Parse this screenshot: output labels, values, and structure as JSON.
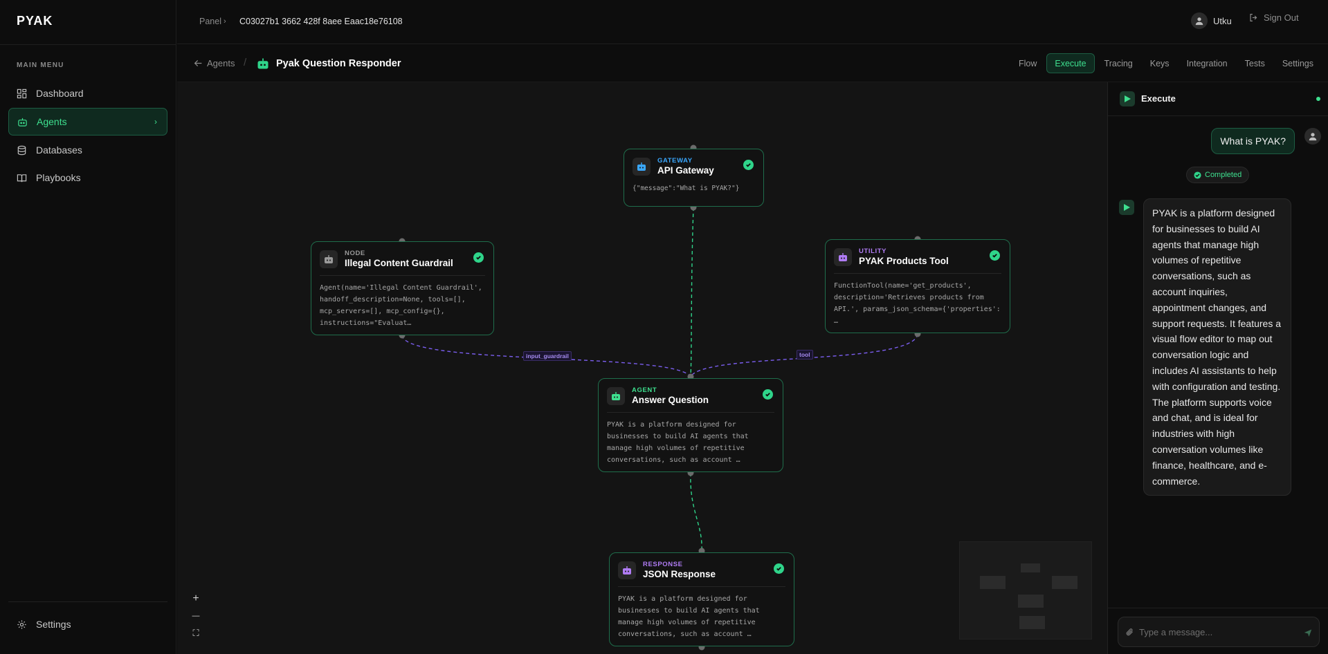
{
  "sidebar": {
    "logo": "PYAK",
    "menu_title": "MAIN MENU",
    "items": [
      {
        "label": "Dashboard"
      },
      {
        "label": "Agents"
      },
      {
        "label": "Databases"
      },
      {
        "label": "Playbooks"
      }
    ],
    "settings_label": "Settings"
  },
  "topbar": {
    "breadcrumb_root": "Panel",
    "breadcrumb_id": "C03027b1 3662 428f 8aee Eaac18e76108",
    "user_name": "Utku",
    "sign_out": "Sign Out"
  },
  "subbar": {
    "back_label": "Agents",
    "agent_name": "Pyak Question Responder",
    "tabs": [
      {
        "label": "Flow"
      },
      {
        "label": "Execute"
      },
      {
        "label": "Tracing"
      },
      {
        "label": "Keys"
      },
      {
        "label": "Integration"
      },
      {
        "label": "Tests"
      },
      {
        "label": "Settings"
      }
    ],
    "active_tab": "Execute"
  },
  "flow": {
    "nodes": {
      "gateway": {
        "type": "GATEWAY",
        "name": "API Gateway",
        "body": "{\"message\":\"What is PYAK?\"}",
        "color": "#3aa8ff"
      },
      "guardrail": {
        "type": "NODE",
        "name": "Illegal Content Guardrail",
        "body": "Agent(name='Illegal Content Guardrail', handoff_description=None, tools=[], mcp_servers=[], mcp_config={}, instructions=\"Evaluat…",
        "color": "#9a9a9a"
      },
      "tool": {
        "type": "UTILITY",
        "name": "PYAK Products Tool",
        "body": "FunctionTool(name='get_products', description='Retrieves products from API.', params_json_schema={'properties': …",
        "color": "#b07cf5"
      },
      "agent": {
        "type": "AGENT",
        "name": "Answer Question",
        "body": "PYAK is a platform designed for businesses to build AI agents that manage high volumes of repetitive conversations, such as account …",
        "color": "#3ee08f"
      },
      "response": {
        "type": "RESPONSE",
        "name": "JSON Response",
        "body": "PYAK is a platform designed for businesses to build AI agents that manage high volumes of repetitive conversations, such as account …",
        "color": "#b07cf5"
      }
    },
    "edge_labels": {
      "guardrail": "input_guardrail",
      "tool": "tool"
    },
    "zoom_in": "+",
    "zoom_out": "—",
    "fit": "⛶"
  },
  "execute": {
    "title": "Execute",
    "user_message": "What is PYAK?",
    "status": "Completed",
    "bot_message": "PYAK is a platform designed for businesses to build AI agents that manage high volumes of repetitive conversations, such as account inquiries, appointment changes, and support requests. It features a visual flow editor to map out conversation logic and includes AI assistants to help with configuration and testing. The platform supports voice and chat, and is ideal for industries with high conversation volumes like finance, healthcare, and e-commerce.",
    "input_placeholder": "Type a message...",
    "accent": "#3ee08f"
  }
}
